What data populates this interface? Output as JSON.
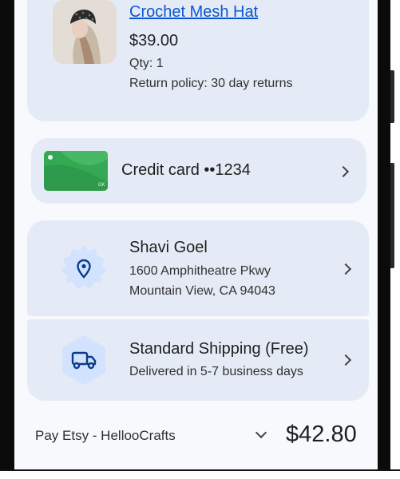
{
  "product": {
    "title": "Crochet Mesh Hat",
    "price": "$39.00",
    "qty": "Qty: 1",
    "return_policy": "Return policy: 30 day returns",
    "thumbnail_icon": "product-photo"
  },
  "payment": {
    "label": "Credit card ••1234",
    "card_color": "#34a853"
  },
  "address": {
    "name": "Shavi Goel",
    "line1": "1600 Amphitheatre Pkwy",
    "line2": "Mountain View, CA 94043",
    "icon": "location-pin-icon"
  },
  "shipping": {
    "title": "Standard Shipping (Free)",
    "subtitle": "Delivered in 5-7 business days",
    "icon": "truck-icon"
  },
  "footer": {
    "merchant": "Pay Etsy - HellooCrafts",
    "total": "$42.80"
  },
  "colors": {
    "card_bg": "#e5ebf6",
    "link": "#0b57d0",
    "badge_bg": "#d3e3fd",
    "icon": "#0b3c8c"
  }
}
